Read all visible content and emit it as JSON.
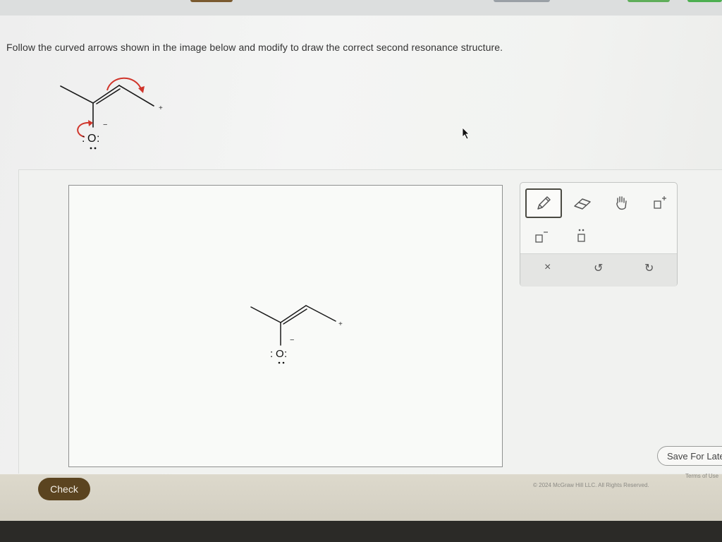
{
  "instruction": "Follow the curved arrows shown in the image below and modify to draw the correct second resonance structure.",
  "molecule": {
    "oxygen": "O",
    "lone_pair_colon": ":",
    "negative_charge": "−",
    "positive_charge": "+"
  },
  "toolbar": {
    "tools": [
      {
        "name": "pencil-icon",
        "selected": true
      },
      {
        "name": "eraser-icon",
        "selected": false
      },
      {
        "name": "hand-icon",
        "selected": false
      },
      {
        "name": "positive-charge-icon",
        "selected": false
      },
      {
        "name": "negative-charge-icon",
        "selected": false
      },
      {
        "name": "lone-pair-icon",
        "selected": false
      }
    ],
    "clear_symbol": "×",
    "undo_symbol": "↺",
    "redo_symbol": "↻"
  },
  "buttons": {
    "check": "Check",
    "save_for_later": "Save For Later"
  },
  "footer": {
    "copyright": "© 2024 McGraw Hill LLC. All Rights Reserved.",
    "terms": "Terms of Use"
  },
  "colors": {
    "arrow_red": "#d0352b",
    "check_button": "#5b4420"
  }
}
